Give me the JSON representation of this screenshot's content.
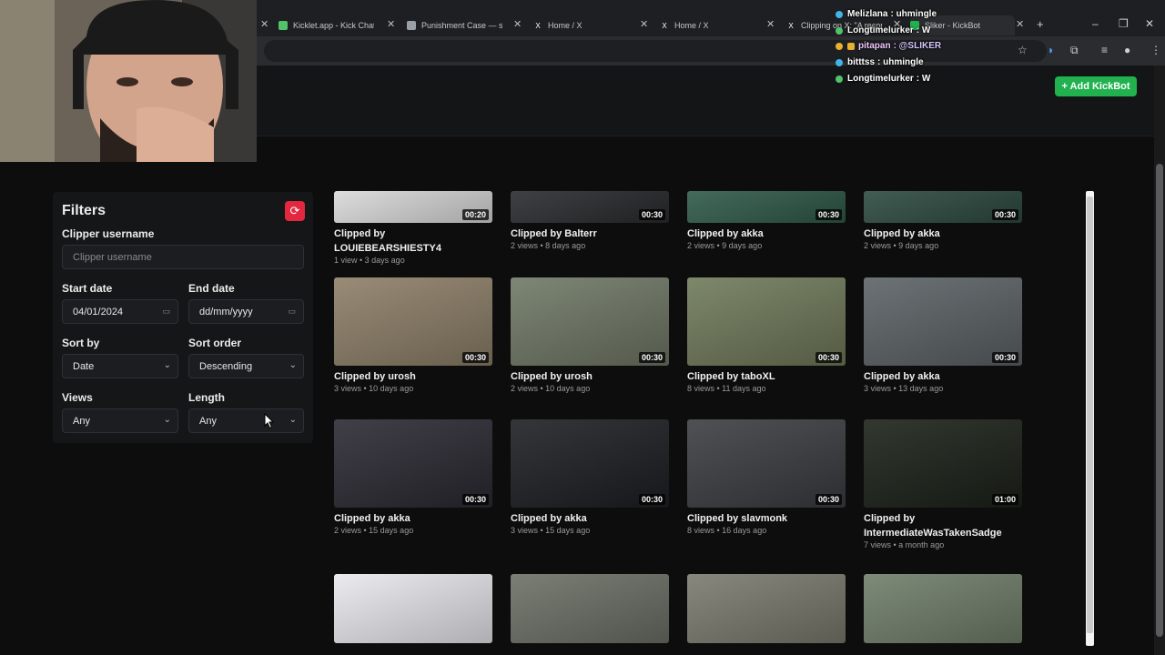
{
  "browser": {
    "tabs": [
      {
        "title": "Kicklet.app - Kick Chatbot",
        "icon_color": "#53c26b"
      },
      {
        "title": "Punishment Case — sliker",
        "icon_color": "#9aa0a6"
      },
      {
        "title": "Home / X",
        "icon_color": "#000000"
      },
      {
        "title": "Home / X",
        "icon_color": "#000000"
      },
      {
        "title": "Clipping on X: \"A record...",
        "icon_color": "#000000"
      },
      {
        "title": "Sliker - KickBot",
        "icon_color": "#21b24f"
      }
    ],
    "new_tab": "+",
    "window_controls": [
      "–",
      "❐",
      "✕"
    ]
  },
  "app": {
    "add_button_label": "+ Add KickBot",
    "accent": "#21b24f"
  },
  "chat": [
    {
      "user": "Melizlana",
      "text": ": uhmingle",
      "badge_color": "#3fb6e8"
    },
    {
      "user": "Longtimelurker",
      "text": ": W",
      "badge_color": "#53c26b"
    },
    {
      "user": "pitapan",
      "text": ": @SLIKER",
      "badge_color": "#e8b030",
      "mention": true
    },
    {
      "user": "bitttss",
      "text": ": uhmingle",
      "badge_color": "#3fb6e8"
    },
    {
      "user": "Longtimelurker",
      "text": ": W",
      "badge_color": "#53c26b"
    }
  ],
  "filters": {
    "title": "Filters",
    "clipper_label": "Clipper username",
    "clipper_placeholder": "Clipper username",
    "start_label": "Start date",
    "start_value": "04/01/2024",
    "end_label": "End date",
    "end_placeholder": "dd/mm/yyyy",
    "sort_by_label": "Sort by",
    "sort_by_value": "Date",
    "sort_order_label": "Sort order",
    "sort_order_value": "Descending",
    "views_label": "Views",
    "views_value": "Any",
    "length_label": "Length",
    "length_value": "Any",
    "refresh_color": "#e2273e"
  },
  "clips": [
    {
      "title": "Clipped by LOUIEBEARSHIESTY4",
      "meta": "1 view • 3 days ago",
      "duration": "00:20",
      "thumb": "#d9d9d9"
    },
    {
      "title": "Clipped by Balterr",
      "meta": "2 views • 8 days ago",
      "duration": "00:30",
      "thumb": "#2a2b2e"
    },
    {
      "title": "Clipped by akka",
      "meta": "2 views • 9 days ago",
      "duration": "00:30",
      "thumb": "#2f5a48"
    },
    {
      "title": "Clipped by akka",
      "meta": "2 views • 9 days ago",
      "duration": "00:30",
      "thumb": "#2d4a40"
    },
    {
      "title": "Clipped by urosh",
      "meta": "3 views • 10 days ago",
      "duration": "00:30",
      "thumb": "#8d7f68"
    },
    {
      "title": "Clipped by urosh",
      "meta": "2 views • 10 days ago",
      "duration": "00:30",
      "thumb": "#6f7866"
    },
    {
      "title": "Clipped by taboXL",
      "meta": "8 views • 11 days ago",
      "duration": "00:30",
      "thumb": "#6f7a5a"
    },
    {
      "title": "Clipped by akka",
      "meta": "3 views • 13 days ago",
      "duration": "00:30",
      "thumb": "#5c6266"
    },
    {
      "title": "Clipped by akka",
      "meta": "2 views • 15 days ago",
      "duration": "00:30",
      "thumb": "#2b2a33"
    },
    {
      "title": "Clipped by akka",
      "meta": "3 views • 15 days ago",
      "duration": "00:30",
      "thumb": "#1e1f24"
    },
    {
      "title": "Clipped by slavmonk",
      "meta": "8 views • 16 days ago",
      "duration": "00:30",
      "thumb": "#3c3d42"
    },
    {
      "title": "Clipped by IntermediateWasTakenSadge",
      "meta": "7 views • a month ago",
      "duration": "01:00",
      "thumb": "#1b2219"
    },
    {
      "title": "",
      "meta": "",
      "duration": "",
      "thumb": "#e8e8ee"
    },
    {
      "title": "",
      "meta": "",
      "duration": "",
      "thumb": "#6c7066"
    },
    {
      "title": "",
      "meta": "",
      "duration": "",
      "thumb": "#7a7a6e"
    },
    {
      "title": "",
      "meta": "",
      "duration": "",
      "thumb": "#707e6a"
    }
  ]
}
